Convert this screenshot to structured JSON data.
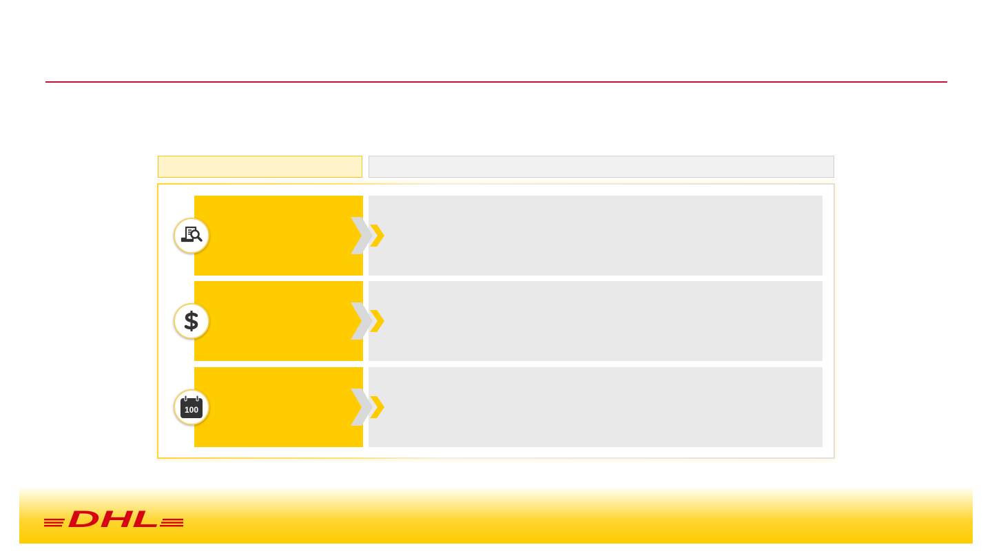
{
  "slide": {
    "title": "",
    "subtitle": "",
    "header_left_label": "",
    "header_right_label": ""
  },
  "rows": [
    {
      "label": "",
      "text": "",
      "icon": "document-search-icon"
    },
    {
      "label": "",
      "text": "",
      "icon": "dollar-icon"
    },
    {
      "label": "",
      "text": "",
      "icon": "calendar-100-icon"
    }
  ],
  "logo": {
    "text": "DHL"
  },
  "colors": {
    "brand_yellow": "#ffcc00",
    "brand_red": "#d40511",
    "title_rule": "#c8102e",
    "row_gray": "#e9e9e9",
    "icon_dark": "#333333"
  }
}
